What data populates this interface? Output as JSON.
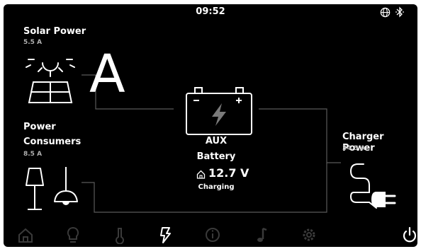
{
  "status_bar": {
    "time": "09:52",
    "icons": [
      "globe-icon",
      "bluetooth-icon"
    ]
  },
  "solar": {
    "title": "Solar Power",
    "value": "5.5 A"
  },
  "consumers": {
    "title_line1": "Power",
    "title_line2": "Consumers",
    "value": "8.5 A"
  },
  "charger": {
    "title": "Charger Power",
    "value": "34.5 A"
  },
  "battery": {
    "line1": "AUX",
    "line2": "Battery",
    "voltage": "12.7 V",
    "status": "Charging"
  },
  "overlay_letter": "A",
  "nav": {
    "items": [
      "home-icon",
      "lightbulb-icon",
      "thermometer-icon",
      "power-icon",
      "info-icon",
      "music-icon",
      "settings-icon"
    ],
    "active": "power-icon",
    "power_button": "power-off-icon"
  },
  "colors": {
    "background": "#000000",
    "foreground": "#ffffff",
    "inactive_nav": "#3a3a3a",
    "lines": "#5a5a5a",
    "subtext": "#b0b0b0"
  }
}
